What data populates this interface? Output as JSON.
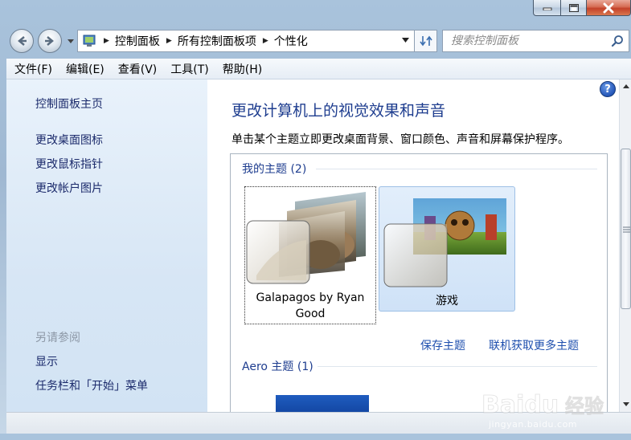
{
  "window": {
    "controls": {
      "minimize": "minimize",
      "maximize": "maximize",
      "close": "close"
    }
  },
  "address": {
    "breadcrumbs": [
      "控制面板",
      "所有控制面板项",
      "个性化"
    ]
  },
  "search": {
    "placeholder": "搜索控制面板"
  },
  "menubar": {
    "items": [
      "文件(F)",
      "编辑(E)",
      "查看(V)",
      "工具(T)",
      "帮助(H)"
    ]
  },
  "sidebar": {
    "home": "控制面板主页",
    "items": [
      "更改桌面图标",
      "更改鼠标指针",
      "更改帐户图片"
    ],
    "see_also_title": "另请参阅",
    "see_also": [
      "显示",
      "任务栏和「开始」菜单"
    ]
  },
  "main": {
    "title": "更改计算机上的视觉效果和声音",
    "description": "单击某个主题立即更改桌面背景、窗口颜色、声音和屏幕保护程序。",
    "my_themes": {
      "heading": "我的主题 (2)",
      "themes": [
        {
          "name": "Galapagos by Ryan Good",
          "name_line1": "Galapagos by Ryan",
          "name_line2": "Good"
        },
        {
          "name": "游戏"
        }
      ],
      "save_link": "保存主题",
      "online_link": "联机获取更多主题"
    },
    "aero": {
      "heading": "Aero 主题 (1)"
    }
  },
  "watermark": {
    "brand": "Baidu",
    "brand_cn": "经验",
    "url": "jingyan.baidu.com"
  },
  "colors": {
    "link": "#1e4fae",
    "title": "#1e3d8f",
    "sidebar_bg": "#d7e6f5"
  }
}
